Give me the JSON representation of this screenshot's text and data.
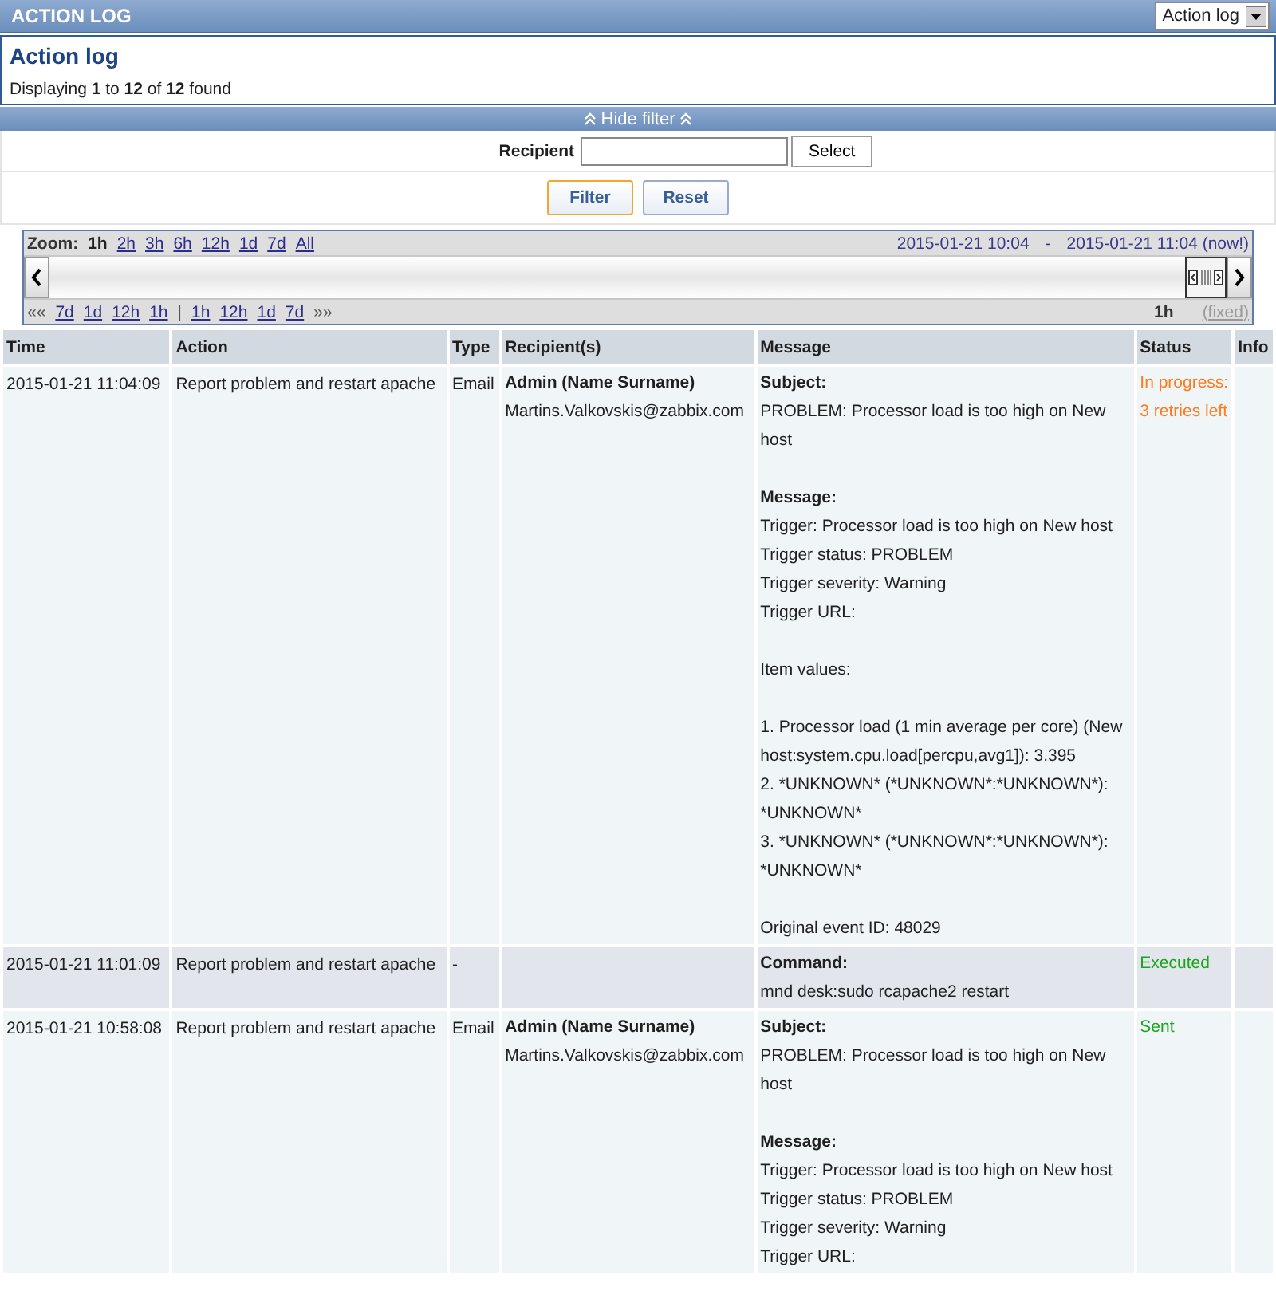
{
  "header": {
    "title": "ACTION LOG",
    "view_select": "Action log"
  },
  "info": {
    "title": "Action log",
    "summary": "Displaying **1** to **12** of **12** found"
  },
  "filter": {
    "toggle": "Hide filter",
    "recipient_label": "Recipient",
    "select_button": "Select",
    "filter_button": "Filter",
    "reset_button": "Reset"
  },
  "timeline": {
    "zoom_label": "Zoom:",
    "zoom_options": [
      {
        "label": "1h",
        "selected": true
      },
      {
        "label": "2h",
        "selected": false
      },
      {
        "label": "3h",
        "selected": false
      },
      {
        "label": "6h",
        "selected": false
      },
      {
        "label": "12h",
        "selected": false
      },
      {
        "label": "1d",
        "selected": false
      },
      {
        "label": "7d",
        "selected": false
      },
      {
        "label": "All",
        "selected": false
      }
    ],
    "range_from": "2015-01-21 10:04",
    "range_sep": "-",
    "range_to": "2015-01-21 11:04 (now!)",
    "back_start": "««",
    "back_links": [
      "7d",
      "1d",
      "12h",
      "1h"
    ],
    "divider": "|",
    "forward_links": [
      "1h",
      "12h",
      "1d",
      "7d"
    ],
    "forward_end": "»»",
    "period": "1h",
    "fixed": "(fixed)"
  },
  "table": {
    "columns": [
      "Time",
      "Action",
      "Type",
      "Recipient(s)",
      "Message",
      "Status",
      "Info"
    ],
    "rows": [
      {
        "time": "2015-01-21 11:04:09",
        "action": "Report problem and restart apache",
        "type": "Email",
        "recipient_name": "Admin (Name Surname)",
        "recipient_address": "Martins.Valkovskis@zabbix.com",
        "message": [
          {
            "heading": "Subject:",
            "lines": [
              "PROBLEM: Processor load is too high on New host"
            ]
          },
          {
            "heading": "Message:",
            "lines": [
              "Trigger: Processor load is too high on New host",
              "Trigger status: PROBLEM",
              "Trigger severity: Warning",
              "Trigger URL:"
            ]
          },
          {
            "lines": [
              "Item values:"
            ]
          },
          {
            "lines": [
              "1. Processor load (1 min average per core) (New host:system.cpu.load[percpu,avg1]): 3.395",
              "2. *UNKNOWN* (*UNKNOWN*:*UNKNOWN*): *UNKNOWN*",
              "3. *UNKNOWN* (*UNKNOWN*:*UNKNOWN*): *UNKNOWN*"
            ]
          },
          {
            "lines": [
              "Original event ID: 48029"
            ]
          }
        ],
        "status": {
          "kind": "in_progress",
          "lines": [
            "In progress:",
            "3 retries left"
          ]
        }
      },
      {
        "time": "2015-01-21 11:01:09",
        "action": "Report problem and restart apache",
        "type": "-",
        "message": [
          {
            "heading": "Command:",
            "lines": [
              "mnd desk:sudo rcapache2 restart"
            ]
          }
        ],
        "status": {
          "kind": "done",
          "lines": [
            "Executed"
          ]
        }
      },
      {
        "time": "2015-01-21 10:58:08",
        "action": "Report problem and restart apache",
        "type": "Email",
        "recipient_name": "Admin (Name Surname)",
        "recipient_address": "Martins.Valkovskis@zabbix.com",
        "message": [
          {
            "heading": "Subject:",
            "lines": [
              "PROBLEM: Processor load is too high on New host"
            ]
          },
          {
            "heading": "Message:",
            "lines": [
              "Trigger: Processor load is too high on New host",
              "Trigger status: PROBLEM",
              "Trigger severity: Warning",
              "Trigger URL:"
            ]
          }
        ],
        "status": {
          "kind": "done",
          "lines": [
            "Sent"
          ]
        }
      }
    ]
  }
}
